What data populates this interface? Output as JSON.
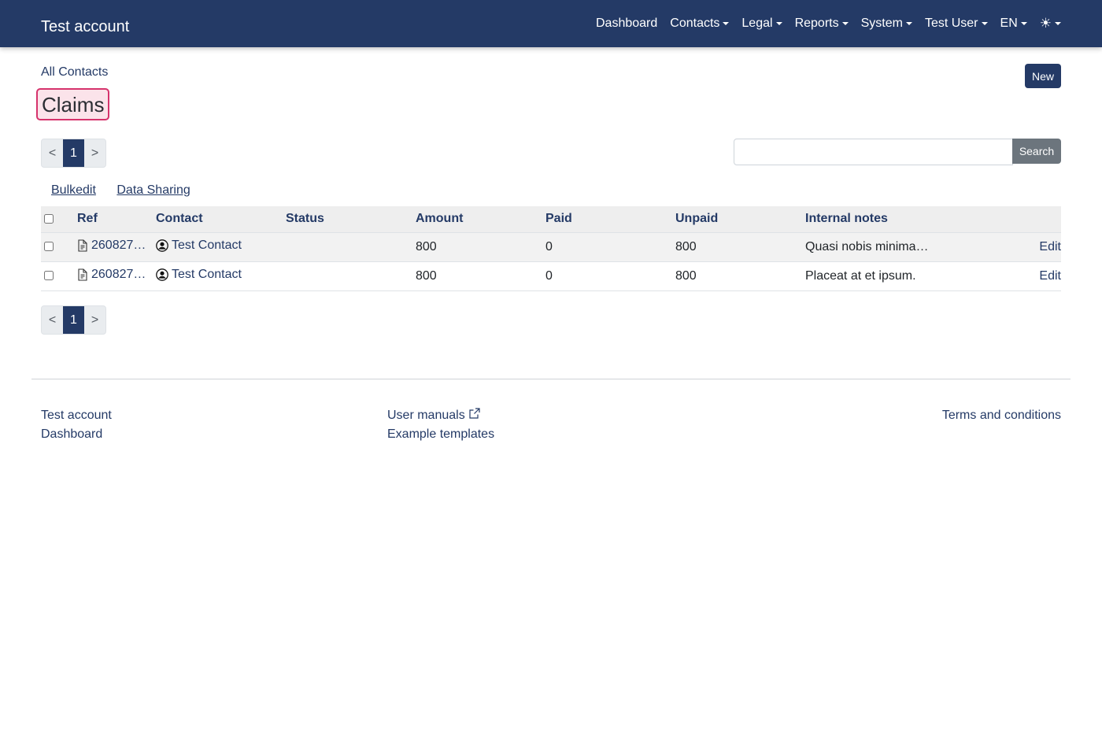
{
  "navbar": {
    "brand": "Test account",
    "items": [
      {
        "label": "Dashboard",
        "dropdown": false
      },
      {
        "label": "Contacts",
        "dropdown": true
      },
      {
        "label": "Legal",
        "dropdown": true
      },
      {
        "label": "Reports",
        "dropdown": true
      },
      {
        "label": "System",
        "dropdown": true
      },
      {
        "label": "Test User",
        "dropdown": true
      },
      {
        "label": "EN",
        "dropdown": true
      }
    ],
    "theme_icon": "sun-icon",
    "theme_glyph": "☀"
  },
  "header": {
    "breadcrumb": "All Contacts",
    "title": "Claims",
    "new_label": "New"
  },
  "pagination": {
    "prev": "<",
    "current": "1",
    "next": ">"
  },
  "search": {
    "value": "",
    "button_label": "Search"
  },
  "bulk": {
    "bulkedit": "Bulkedit",
    "data_sharing": "Data Sharing"
  },
  "table": {
    "columns": [
      "Ref",
      "Contact",
      "Status",
      "Amount",
      "Paid",
      "Unpaid",
      "Internal notes"
    ],
    "rows": [
      {
        "ref": "260827…",
        "contact": "Test Contact",
        "status": "",
        "amount": "800",
        "paid": "0",
        "unpaid": "800",
        "notes": "Quasi nobis minima…",
        "edit": "Edit"
      },
      {
        "ref": "260827…",
        "contact": "Test Contact",
        "status": "",
        "amount": "800",
        "paid": "0",
        "unpaid": "800",
        "notes": "Placeat at et ipsum.",
        "edit": "Edit"
      }
    ]
  },
  "footer": {
    "left": [
      "Test account",
      "Dashboard"
    ],
    "middle": [
      "User manuals",
      "Example templates"
    ],
    "right": [
      "Terms and conditions"
    ]
  },
  "colors": {
    "primary": "#243a66",
    "highlight_border": "#d6336c",
    "highlight_bg": "#fbe3ea",
    "search_button": "#6c757d"
  }
}
